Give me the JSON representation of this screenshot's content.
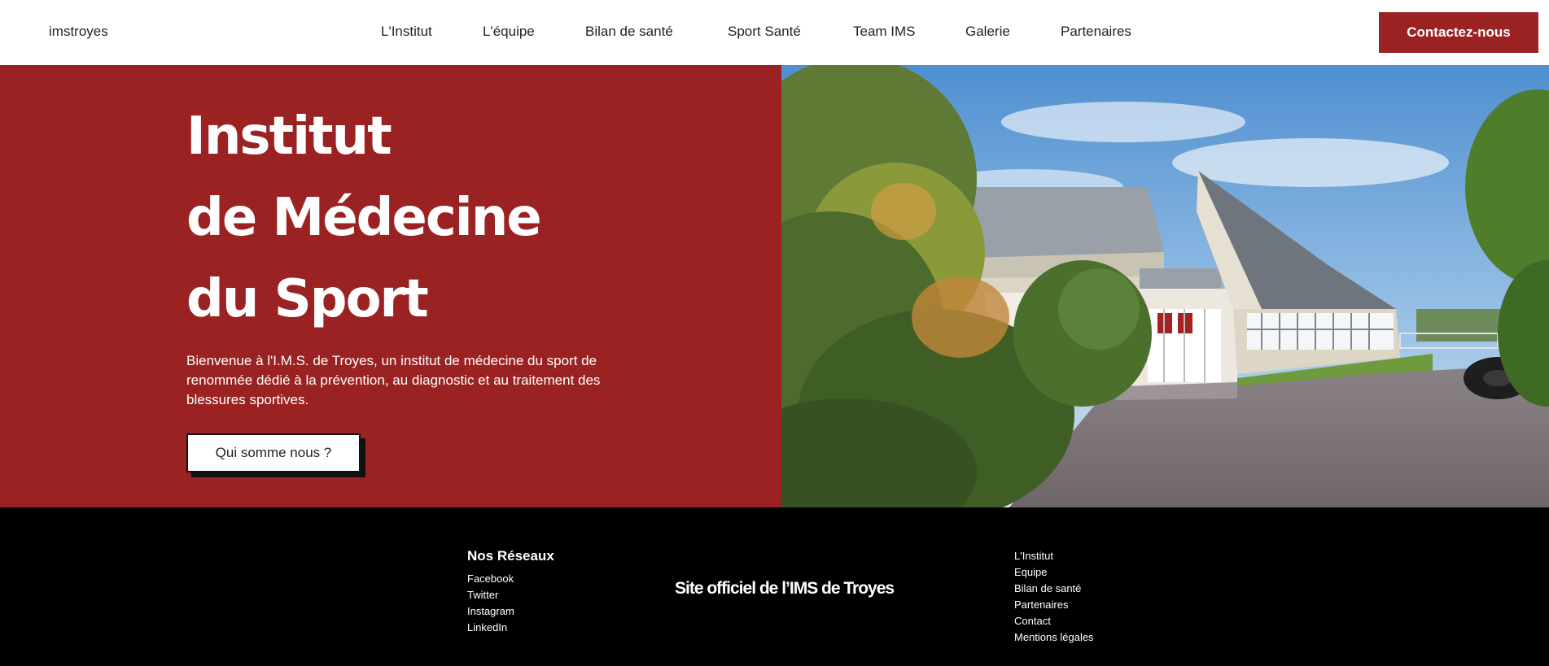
{
  "header": {
    "brand": "imstroyes",
    "nav": [
      "L'Institut",
      "L'équipe",
      "Bilan de santé",
      "Sport Santé",
      "Team IMS",
      "Galerie",
      "Partenaires"
    ],
    "cta": "Contactez-nous"
  },
  "hero": {
    "title_lines": [
      "Institut",
      "de Médecine",
      "du Sport"
    ],
    "description": "Bienvenue à l'I.M.S. de Troyes, un institut de médecine du sport de renommée dédié à la prévention, au diagnostic et au traitement des blessures sportives.",
    "button": "Qui somme nous ?"
  },
  "footer": {
    "socials_heading": "Nos Réseaux",
    "socials": [
      "Facebook",
      "Twitter",
      "Instagram",
      "LinkedIn"
    ],
    "tagline": "Site officiel de l’IMS de Troyes",
    "links": [
      "L'Institut",
      "Equipe",
      "Bilan de santé",
      "Partenaires",
      "Contact",
      "Mentions légales"
    ]
  },
  "colors": {
    "brand_red": "#9b2222",
    "footer_bg": "#000000"
  }
}
